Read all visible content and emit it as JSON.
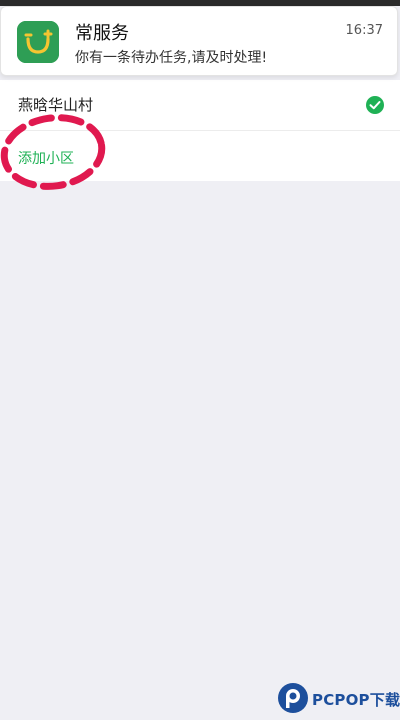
{
  "notification": {
    "app_name": "常服务",
    "message": "你有一条待办任务,请及时处理!",
    "time": "16:37",
    "icon": "app-logo-icon"
  },
  "list": {
    "items": [
      {
        "label": "燕晗华山村",
        "selected": true,
        "icon": "check-circle-icon"
      }
    ],
    "add_label": "添加小区"
  },
  "colors": {
    "accent": "#1fb155",
    "annotation": "#e0194f",
    "background": "#efeff4",
    "watermark": "#1d4f9c"
  },
  "watermark": {
    "text": "PCPOP下载"
  }
}
